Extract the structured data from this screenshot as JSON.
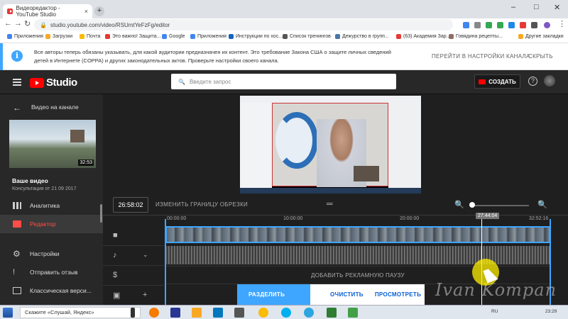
{
  "browser": {
    "tab_title": "Видеоредактор - YouTube Studio",
    "tab_close": "×",
    "new_tab": "+",
    "url": "studio.youtube.com/video/RSUmtYeFzFg/editor",
    "minimize": "–",
    "maximize": "□",
    "close": "✕",
    "bookmarks": [
      {
        "label": "Приложения",
        "color": "#4285f4"
      },
      {
        "label": "Загрузки",
        "color": "#f9a825"
      },
      {
        "label": "Почта",
        "color": "#fbbc05"
      },
      {
        "label": "Это важно! Защита...",
        "color": "#e53935"
      },
      {
        "label": "Google",
        "color": "#4285f4"
      },
      {
        "label": "Приложения",
        "color": "#4285f4"
      },
      {
        "label": "Инструкции по хос...",
        "color": "#1565c0"
      },
      {
        "label": "Список тренингов",
        "color": "#555555"
      },
      {
        "label": "Дежурство в групп...",
        "color": "#4a76a8"
      },
      {
        "label": "(63) Академия Зар...",
        "color": "#e53935"
      },
      {
        "label": "Говядина рецепты...",
        "color": "#8d6e63"
      }
    ],
    "other_bookmarks": "Другие закладки"
  },
  "notice": {
    "icon": "i",
    "text": "Все авторы теперь обязаны указывать, для какой аудитории предназначен их контент. Это требование Закона США о защите личных сведений детей в Интернете (COPPA) и других законодательных актов. Проверьте настройки своего канала.",
    "settings_link": "ПЕРЕЙТИ В НАСТРОЙКИ КАНАЛА",
    "hide_link": "СКРЫТЬ"
  },
  "header": {
    "logo_text": "Studio",
    "search_placeholder": "Введите запрос",
    "create_label": "СОЗДАТЬ",
    "help_icon": "?"
  },
  "sidebar": {
    "back_label": "Видео на канале",
    "thumbnail_duration": "32:53",
    "video_title": "Ваше видео",
    "video_subtitle": "Консультация от 21 09 2017",
    "items": [
      {
        "label": "Аналитика",
        "icon": "analytics-icon"
      },
      {
        "label": "Редактор",
        "icon": "editor-icon",
        "active": true
      },
      {
        "label": "Настройки",
        "icon": "gear-icon"
      },
      {
        "label": "Отправить отзыв",
        "icon": "feedback-icon"
      },
      {
        "label": "Классическая верси...",
        "icon": "classic-icon"
      }
    ]
  },
  "editor": {
    "time_display": "26:58:02",
    "trim_label": "ИЗМЕНИТЬ ГРАНИЦУ ОБРЕЗКИ",
    "ruler": [
      "00:00:00",
      "10:00:00",
      "20:00:00",
      "32:52:16"
    ],
    "playhead_time": "27:44:04",
    "ad_break_label": "ДОБАВИТЬ РЕКЛАМНУЮ ПАУЗУ",
    "split_label": "РАЗДЕЛИТЬ",
    "clear_label": "ОЧИСТИТЬ",
    "preview_label": "ПРОСМОТРЕТЬ",
    "watermark": "Ivan Kompan",
    "zoom_level": 0.02
  },
  "taskbar": {
    "search_text": "Скажите «Слушай, Яндекс»",
    "language": "RU",
    "time": "23:29"
  },
  "colors": {
    "accent": "#3ea6ff",
    "brand_red": "#ff0000",
    "active_red": "#ff4e45"
  }
}
